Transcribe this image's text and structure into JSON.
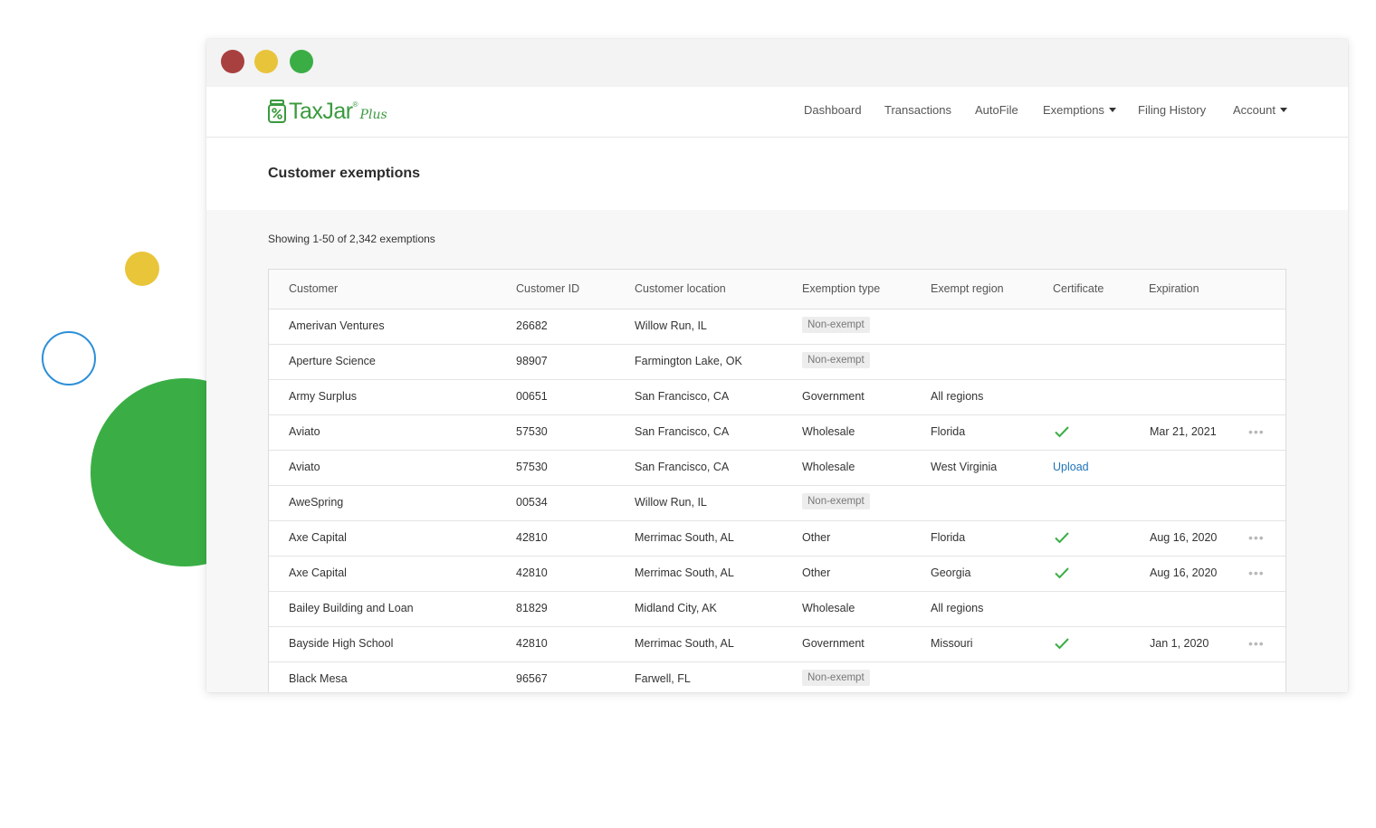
{
  "brand": {
    "name": "TaxJar",
    "reg": "®",
    "plus": "Plus",
    "color": "#3a9a3e"
  },
  "nav": [
    {
      "label": "Dashboard",
      "dropdown": false
    },
    {
      "label": "Transactions",
      "dropdown": false
    },
    {
      "label": "AutoFile",
      "dropdown": false
    },
    {
      "label": "Exemptions",
      "dropdown": true
    },
    {
      "label": "Filing History",
      "dropdown": false
    },
    {
      "label": "Account",
      "dropdown": true
    }
  ],
  "page": {
    "title": "Customer exemptions",
    "showing": "Showing 1-50 of 2,342 exemptions"
  },
  "table": {
    "headers": [
      "Customer",
      "Customer ID",
      "Customer location",
      "Exemption type",
      "Exempt region",
      "Certificate",
      "Expiration"
    ],
    "rows": [
      {
        "customer": "Amerivan Ventures",
        "id": "26682",
        "location": "Willow Run, IL",
        "type": "Non-exempt",
        "type_badge": true,
        "region": "",
        "certificate": "",
        "expiration": "",
        "menu": false
      },
      {
        "customer": "Aperture Science",
        "id": "98907",
        "location": "Farmington Lake, OK",
        "type": "Non-exempt",
        "type_badge": true,
        "region": "",
        "certificate": "",
        "expiration": "",
        "menu": false
      },
      {
        "customer": "Army Surplus",
        "id": "00651",
        "location": "San Francisco, CA",
        "type": "Government",
        "type_badge": false,
        "region": "All regions",
        "certificate": "",
        "expiration": "",
        "menu": false
      },
      {
        "customer": "Aviato",
        "id": "57530",
        "location": "San Francisco, CA",
        "type": "Wholesale",
        "type_badge": false,
        "region": "Florida",
        "certificate": "check",
        "expiration": "Mar 21, 2021",
        "menu": true
      },
      {
        "customer": "Aviato",
        "id": "57530",
        "location": "San Francisco, CA",
        "type": "Wholesale",
        "type_badge": false,
        "region": "West Virginia",
        "certificate": "Upload",
        "expiration": "",
        "menu": false
      },
      {
        "customer": "AweSpring",
        "id": "00534",
        "location": "Willow Run, IL",
        "type": "Non-exempt",
        "type_badge": true,
        "region": "",
        "certificate": "",
        "expiration": "",
        "menu": false
      },
      {
        "customer": "Axe Capital",
        "id": "42810",
        "location": "Merrimac South, AL",
        "type": "Other",
        "type_badge": false,
        "region": "Florida",
        "certificate": "check",
        "expiration": "Aug 16, 2020",
        "menu": true
      },
      {
        "customer": "Axe Capital",
        "id": "42810",
        "location": "Merrimac South, AL",
        "type": "Other",
        "type_badge": false,
        "region": "Georgia",
        "certificate": "check",
        "expiration": "Aug 16, 2020",
        "menu": true
      },
      {
        "customer": "Bailey Building and Loan",
        "id": "81829",
        "location": "Midland City, AK",
        "type": "Wholesale",
        "type_badge": false,
        "region": "All regions",
        "certificate": "",
        "expiration": "",
        "menu": false
      },
      {
        "customer": "Bayside High School",
        "id": "42810",
        "location": "Merrimac South, AL",
        "type": "Government",
        "type_badge": false,
        "region": "Missouri",
        "certificate": "check",
        "expiration": "Jan 1, 2020",
        "menu": true
      },
      {
        "customer": "Black Mesa",
        "id": "96567",
        "location": "Farwell, FL",
        "type": "Non-exempt",
        "type_badge": true,
        "region": "",
        "certificate": "",
        "expiration": "",
        "menu": false
      }
    ]
  },
  "colors": {
    "accent_green": "#3aae45",
    "link_blue": "#1f73b7",
    "dot_red": "#a94040",
    "dot_yellow": "#e8c43b"
  },
  "icons": {
    "certificate_check": "checkmark-icon",
    "row_menu": "more-horizontal-icon"
  }
}
